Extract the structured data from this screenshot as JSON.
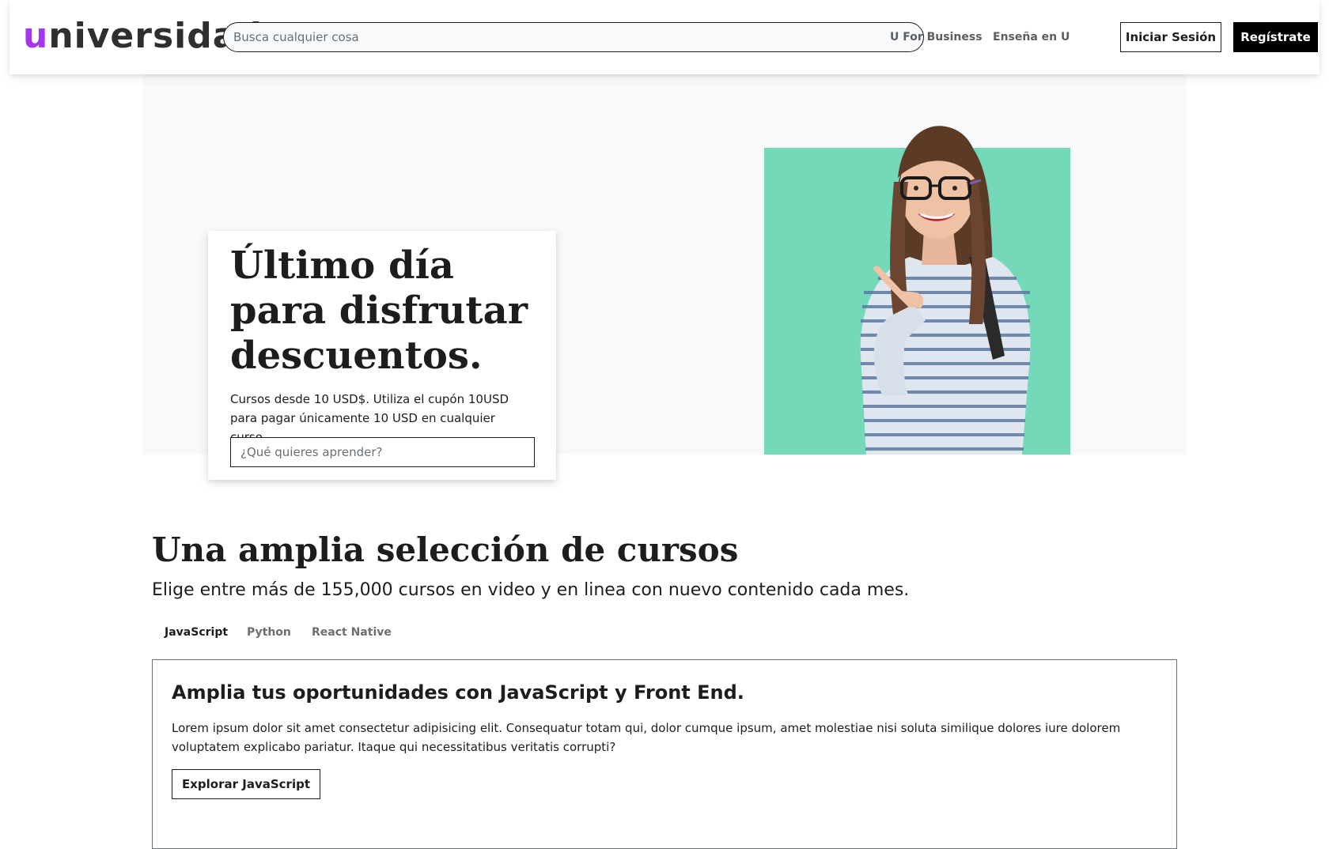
{
  "header": {
    "logo_first": "u",
    "logo_rest": "niversidad",
    "search_placeholder": "Busca cualquier cosa",
    "links": [
      "U For Business",
      "Enseña en U"
    ],
    "login_label": "Iniciar Sesión",
    "signup_label": "Regístrate"
  },
  "hero": {
    "title": "Último día para disfrutar descuentos.",
    "text": "Cursos desde 10 USD$. Utiliza el cupón 10USD para pagar únicamente 10 USD en cualquier curso.",
    "search_placeholder": "¿Qué quieres aprender?"
  },
  "courses": {
    "title": "Una amplia selección de cursos",
    "subtitle": "Elige entre más de 155,000 cursos en video y en linea con nuevo contenido cada mes.",
    "tabs": [
      "JavaScript",
      "Python",
      "React Native"
    ],
    "active_tab": "JavaScript",
    "panel": {
      "title": "Amplia tus oportunidades con JavaScript y Front End.",
      "text": "Lorem ipsum dolor sit amet consectetur adipisicing elit. Consequatur totam qui, dolor cumque ipsum, amet molestiae nisi soluta similique dolores iure dolorem voluptatem explicabo pariatur. Itaque qui necessitatibus veritatis corrupti?",
      "button_label": "Explorar JavaScript"
    }
  },
  "colors": {
    "brand_purple": "#a435f0",
    "hero_green": "#73d9b9",
    "hero_bg": "#f7f9fa"
  }
}
